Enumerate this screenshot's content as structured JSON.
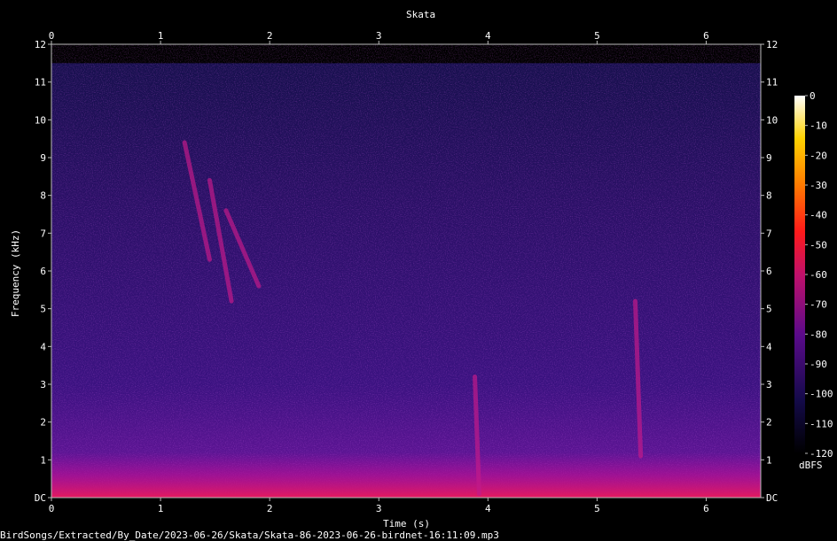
{
  "chart_data": {
    "type": "heatmap",
    "title": "Skata",
    "xlabel": "Time (s)",
    "ylabel": "Frequency (kHz)",
    "xlim": [
      0,
      6.5
    ],
    "ylim": [
      0,
      12
    ],
    "x_ticks": [
      "0",
      "1",
      "2",
      "3",
      "4",
      "5",
      "6"
    ],
    "y_ticks": [
      "DC",
      "1",
      "2",
      "3",
      "4",
      "5",
      "6",
      "7",
      "8",
      "9",
      "10",
      "11",
      "12"
    ],
    "colorbar": {
      "label": "dBFS",
      "range": [
        -120,
        0
      ],
      "ticks": [
        "0",
        "-10",
        "-20",
        "-30",
        "-40",
        "-50",
        "-60",
        "-70",
        "-80",
        "-90",
        "-100",
        "-110",
        "-120"
      ]
    },
    "footer": "BirdSongs/Extracted/By_Date/2023-06-26/Skata/Skata-86-2023-06-26-birdnet-16:11:09.mp3",
    "noise_floor_top_khz": 11.5,
    "calls": [
      {
        "t_start": 1.22,
        "t_end": 1.45,
        "f_start": 9.4,
        "f_end": 6.3
      },
      {
        "t_start": 1.45,
        "t_end": 1.65,
        "f_start": 8.4,
        "f_end": 5.2
      },
      {
        "t_start": 1.6,
        "t_end": 1.9,
        "f_start": 7.6,
        "f_end": 5.6
      },
      {
        "t_start": 3.88,
        "t_end": 3.92,
        "f_start": 3.2,
        "f_end": 0.1
      },
      {
        "t_start": 5.35,
        "t_end": 5.4,
        "f_start": 5.2,
        "f_end": 1.1
      }
    ]
  }
}
